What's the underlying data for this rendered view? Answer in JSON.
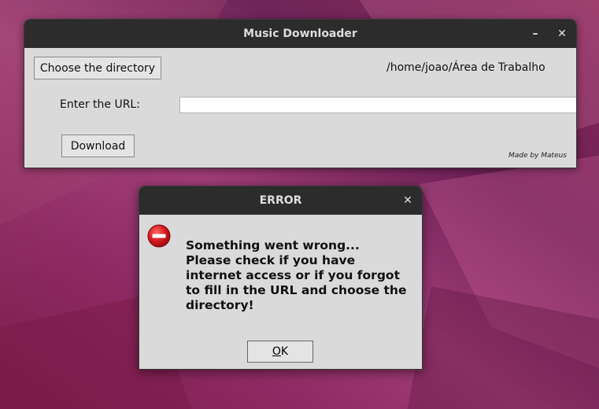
{
  "main_window": {
    "title": "Music Downloader",
    "minimize_glyph": "–",
    "close_glyph": "✕",
    "choose_directory_label": "Choose the directory",
    "directory_path": "/home/joao/Área de Trabalho",
    "url_label": "Enter the URL:",
    "url_value": "",
    "download_label": "Download",
    "credit": "Made by Mateus"
  },
  "error_dialog": {
    "title": "ERROR",
    "close_glyph": "✕",
    "icon": "error-stop-icon",
    "message_lines": [
      "Something went wrong...",
      "Please check if you have",
      "internet access or if you forgot",
      "to fill in the URL and choose the",
      "directory!"
    ],
    "ok_mnemonic": "O",
    "ok_rest": "K"
  },
  "colors": {
    "titlebar": "#2c2c2c",
    "window_bg": "#dadada",
    "error_icon_red": "#d7191c"
  }
}
